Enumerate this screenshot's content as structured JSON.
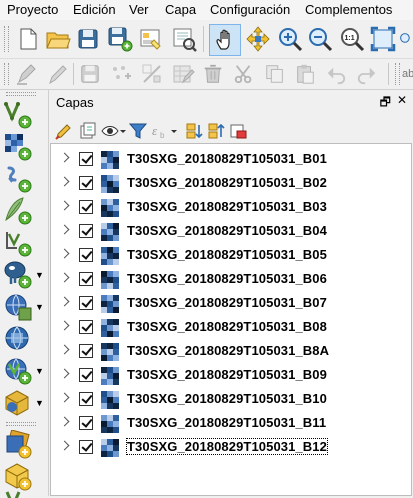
{
  "menubar": {
    "items": [
      "Proyecto",
      "Edición",
      "Ver",
      "Capa",
      "Configuración",
      "Complementos"
    ]
  },
  "toolbar_main": {
    "icons": [
      "new-project-icon",
      "open-project-icon",
      "save-project-icon",
      "save-as-icon",
      "print-layout-icon",
      "style-manager-icon",
      "pan-icon",
      "pan-to-selection-icon",
      "zoom-in-icon",
      "zoom-out-icon",
      "zoom-native-icon",
      "zoom-full-icon"
    ]
  },
  "toolbar_edit": {
    "icons": [
      "digitize-icon",
      "toggle-edit-icon",
      "save-edits-icon",
      "add-feature-icon",
      "vertex-tool-icon",
      "delete-selected-icon",
      "cut-icon",
      "copy-icon",
      "paste-icon",
      "undo-icon",
      "redo-icon"
    ],
    "partial_label": "ab"
  },
  "left_toolbar": {
    "icons": [
      "add-vector-icon",
      "add-raster-icon",
      "add-delimited-text-icon",
      "add-spatialite-icon",
      "add-virtual-layer-icon",
      "add-postgis-icon",
      "add-wms-icon",
      "add-wcs-icon",
      "add-wfs-icon",
      "add-arcgis-icon",
      "new-geopackage-icon",
      "new-shapefile-icon",
      "new-spatialite-icon"
    ]
  },
  "layers_panel": {
    "title": "Capas",
    "float_glyph": "🗗",
    "close_glyph": "✕",
    "layers": [
      {
        "name": "T30SXG_20180829T105031_B01",
        "checked": true
      },
      {
        "name": "T30SXG_20180829T105031_B02",
        "checked": true
      },
      {
        "name": "T30SXG_20180829T105031_B03",
        "checked": true
      },
      {
        "name": "T30SXG_20180829T105031_B04",
        "checked": true
      },
      {
        "name": "T30SXG_20180829T105031_B05",
        "checked": true
      },
      {
        "name": "T30SXG_20180829T105031_B06",
        "checked": true
      },
      {
        "name": "T30SXG_20180829T105031_B07",
        "checked": true
      },
      {
        "name": "T30SXG_20180829T105031_B08",
        "checked": true
      },
      {
        "name": "T30SXG_20180829T105031_B8A",
        "checked": true
      },
      {
        "name": "T30SXG_20180829T105031_B09",
        "checked": true
      },
      {
        "name": "T30SXG_20180829T105031_B10",
        "checked": true
      },
      {
        "name": "T30SXG_20180829T105031_B11",
        "checked": true
      },
      {
        "name": "T30SXG_20180829T105031_B12",
        "checked": true,
        "selected": true
      }
    ]
  }
}
